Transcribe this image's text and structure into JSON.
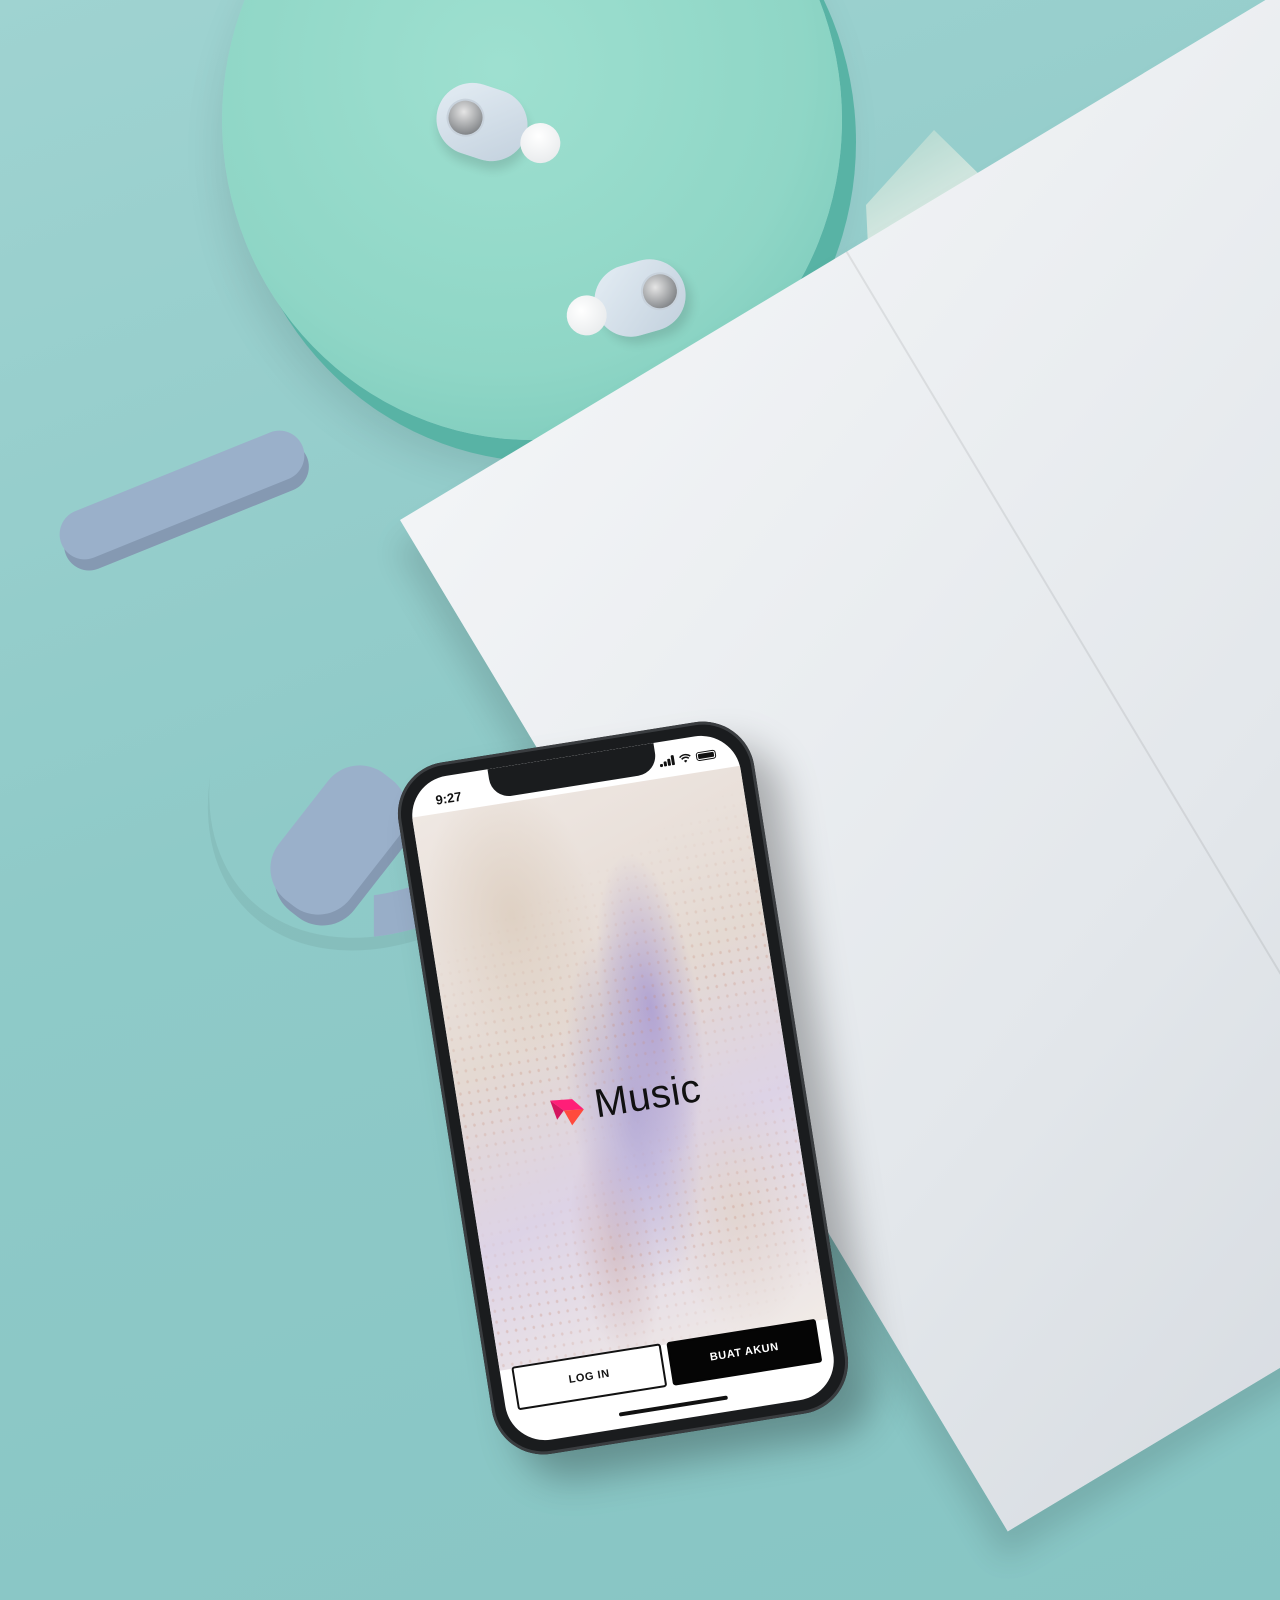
{
  "status_bar": {
    "time": "9:27"
  },
  "app": {
    "name": "Music",
    "logo_icon": "pink-arrow-logo-icon",
    "logo_colors": [
      "#ff1e78",
      "#ff4a3d"
    ]
  },
  "actions": {
    "login_label": "LOG IN",
    "signup_label": "BUAT AKUN"
  }
}
